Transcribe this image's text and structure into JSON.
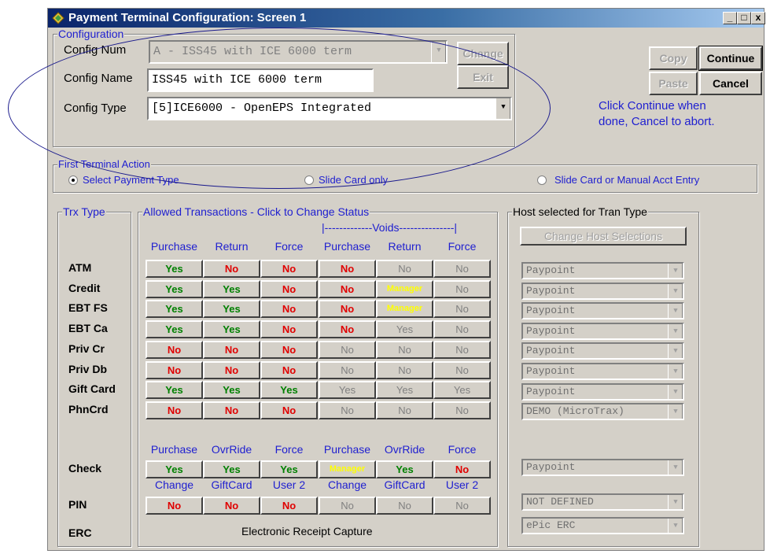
{
  "window": {
    "title": "Payment Terminal Configuration:  Screen 1",
    "min": "_",
    "max": "□",
    "close": "x"
  },
  "config": {
    "group_label": "Configuration",
    "num_label": "Config Num",
    "num_value": "A - ISS45 with ICE 6000 term",
    "name_label": "Config Name",
    "name_value": "ISS45 with ICE 6000 term",
    "type_label": "Config Type",
    "type_value": "[5]ICE6000 - OpenEPS Integrated",
    "change_btn": "Change",
    "exit_btn": "Exit"
  },
  "actions": {
    "copy": "Copy",
    "continue": "Continue",
    "paste": "Paste",
    "cancel": "Cancel",
    "hint": "Click Continue when\ndone, Cancel to abort."
  },
  "first_action": {
    "group_label": "First Terminal Action",
    "options": [
      "Select Payment Type",
      "Slide Card only",
      "Slide Card or Manual Acct Entry"
    ],
    "selected": 0
  },
  "trx_type_label": "Trx Type",
  "allowed_label": "Allowed Transactions - Click to Change Status",
  "voids_label": "|-------------Voids---------------|",
  "headers": [
    "Purchase",
    "Return",
    "Force",
    "Purchase",
    "Return",
    "Force"
  ],
  "rows": [
    {
      "name": "ATM",
      "cells": [
        "Yes",
        "No",
        "No",
        "No",
        "No",
        "No"
      ]
    },
    {
      "name": "Credit",
      "cells": [
        "Yes",
        "Yes",
        "No",
        "No",
        "Manager",
        "No"
      ]
    },
    {
      "name": "EBT FS",
      "cells": [
        "Yes",
        "Yes",
        "No",
        "No",
        "Manager",
        "No"
      ]
    },
    {
      "name": "EBT Ca",
      "cells": [
        "Yes",
        "Yes",
        "No",
        "No",
        "Yes",
        "No"
      ]
    },
    {
      "name": "Priv Cr",
      "cells": [
        "No",
        "No",
        "No",
        "No",
        "No",
        "No"
      ]
    },
    {
      "name": "Priv Db",
      "cells": [
        "No",
        "No",
        "No",
        "No",
        "No",
        "No"
      ]
    },
    {
      "name": "Gift Card",
      "cells": [
        "Yes",
        "Yes",
        "Yes",
        "Yes",
        "Yes",
        "Yes"
      ]
    },
    {
      "name": "PhnCrd",
      "cells": [
        "No",
        "No",
        "No",
        "No",
        "No",
        "No"
      ]
    }
  ],
  "check_headers": [
    "Purchase",
    "OvrRide",
    "Force",
    "Purchase",
    "OvrRide",
    "Force"
  ],
  "check_row": {
    "name": "Check",
    "cells": [
      "Yes",
      "Yes",
      "Yes",
      "Manager",
      "Yes",
      "No"
    ]
  },
  "pin_headers": [
    "Change",
    "GiftCard",
    "User 2",
    "Change",
    "GiftCard",
    "User 2"
  ],
  "pin_row": {
    "name": "PIN",
    "cells": [
      "No",
      "No",
      "No",
      "No",
      "No",
      "No"
    ]
  },
  "erc_row": {
    "name": "ERC",
    "text": "Electronic Receipt Capture"
  },
  "host": {
    "group_label": "Host selected for Tran Type",
    "change_btn": "Change Host Selections",
    "values": [
      "Paypoint",
      "Paypoint",
      "Paypoint",
      "Paypoint",
      "Paypoint",
      "Paypoint",
      "Paypoint",
      "DEMO (MicroTrax)"
    ],
    "check_value": "Paypoint",
    "pin_value": "NOT DEFINED",
    "erc_value": "ePic ERC"
  },
  "colors": {
    "yes": "#008000",
    "no": "#e00000",
    "manager": "#ffff00",
    "disabled": "#808080",
    "label_blue": "#2020d0"
  }
}
